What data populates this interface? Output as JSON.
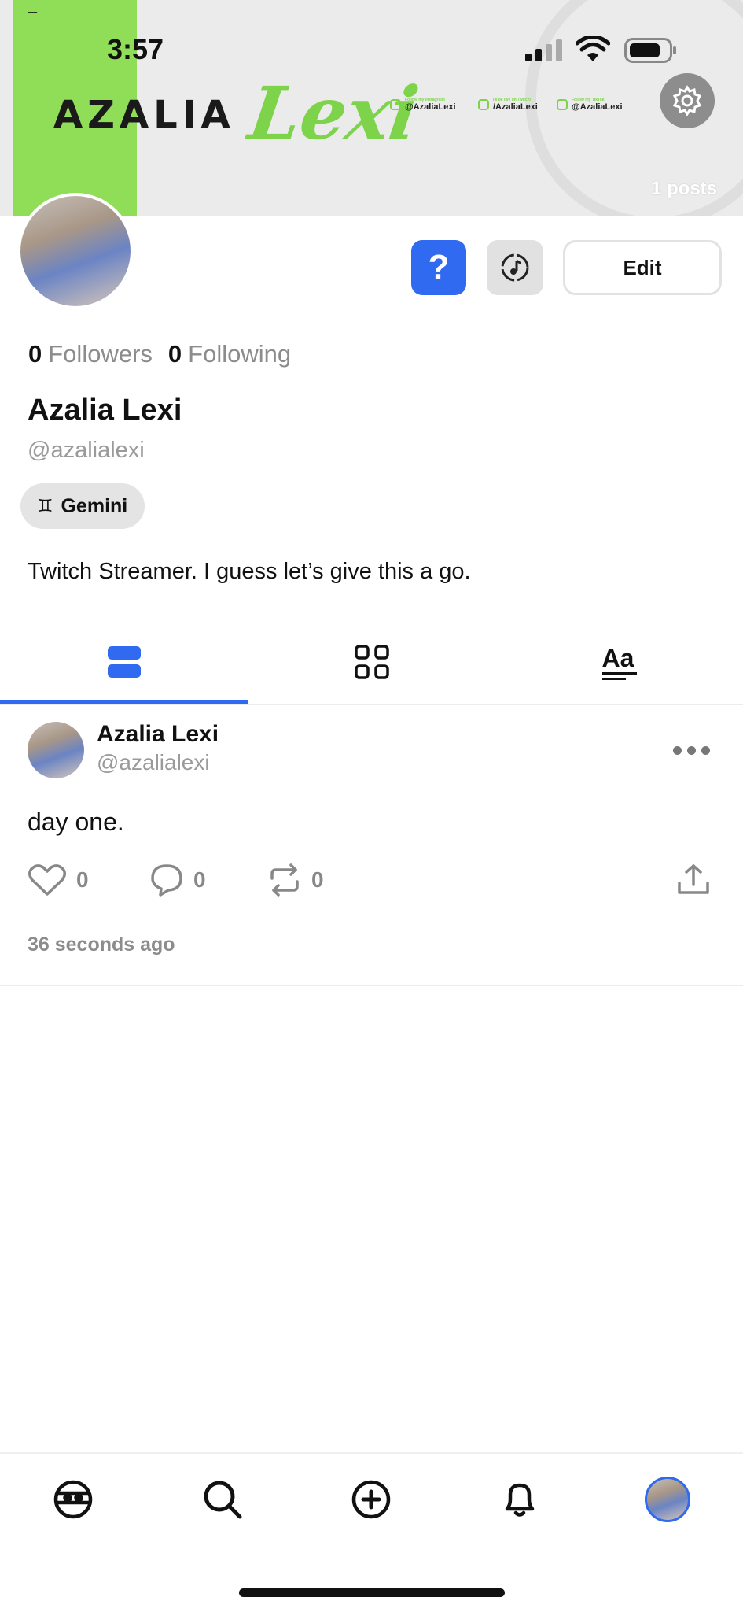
{
  "status_bar": {
    "time": "3:57",
    "dash": "–"
  },
  "banner": {
    "logo_main": "AZALIA",
    "logo_script": "Lexi",
    "socials": [
      {
        "caption": "Follow my Instagram!",
        "handle": "@AzaliaLexi"
      },
      {
        "caption": "I'll be live on Twitch!",
        "handle": "/AzaliaLexi"
      },
      {
        "caption": "Follow my TikTok!",
        "handle": "@AzaliaLexi"
      }
    ],
    "posts_count": "1 posts"
  },
  "actions": {
    "help_label": "?",
    "edit_label": "Edit"
  },
  "profile": {
    "followers_count": "0",
    "followers_label": "Followers",
    "following_count": "0",
    "following_label": "Following",
    "display_name": "Azalia Lexi",
    "handle": "@azalialexi",
    "sign_symbol": "♊",
    "sign_label": "Gemini",
    "bio": "Twitch Streamer. I guess let’s give this a go."
  },
  "tabs": [
    {
      "name": "posts",
      "active": true
    },
    {
      "name": "grid",
      "active": false
    },
    {
      "name": "text",
      "active": false,
      "glyph": "Aa"
    }
  ],
  "post": {
    "author_name": "Azalia Lexi",
    "author_handle": "@azalialexi",
    "text": "day one.",
    "likes": "0",
    "comments": "0",
    "reposts": "0",
    "time": "36 seconds ago"
  },
  "colors": {
    "accent": "#2f6af0",
    "brand_green": "#90dd57",
    "muted": "#8c8c8c"
  },
  "icons": [
    "signal-icon",
    "wifi-icon",
    "battery-icon",
    "gear-icon",
    "help-icon",
    "music-icon",
    "stack-icon",
    "grid-icon",
    "text-icon",
    "heart-icon",
    "comment-icon",
    "repost-icon",
    "share-icon",
    "more-icon",
    "home-icon",
    "search-icon",
    "add-icon",
    "bell-icon"
  ]
}
